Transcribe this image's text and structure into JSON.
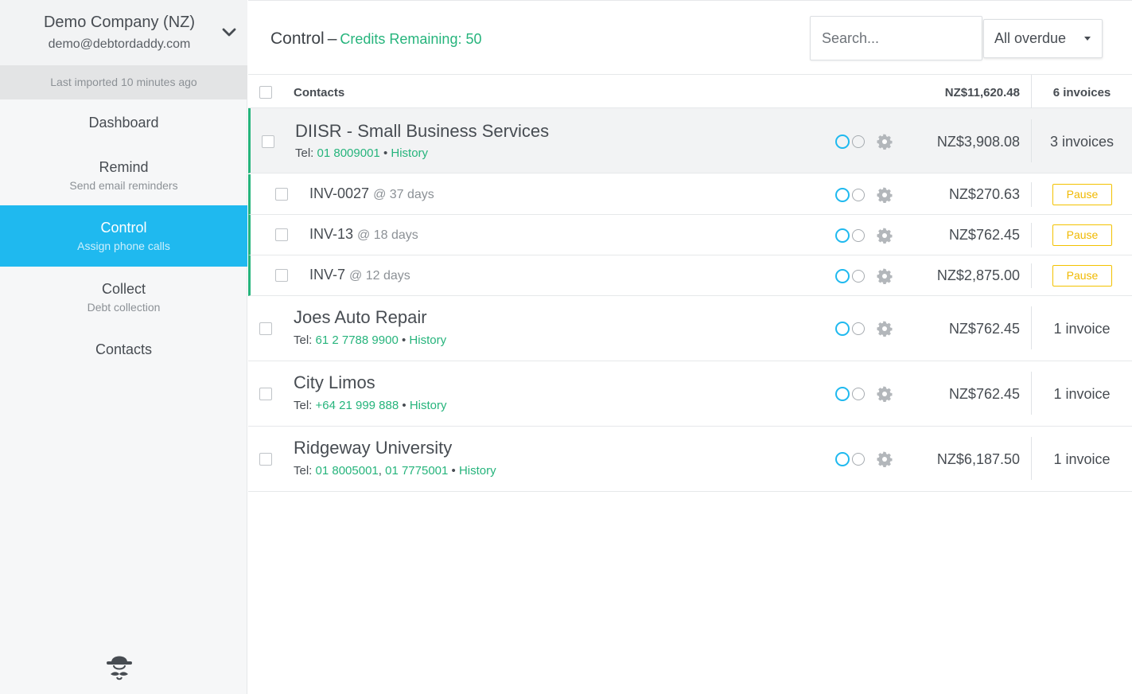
{
  "company": {
    "name": "Demo Company (NZ)",
    "email": "demo@debtordaddy.com",
    "last_imported": "Last imported 10 minutes ago"
  },
  "nav": [
    {
      "title": "Dashboard",
      "subtitle": ""
    },
    {
      "title": "Remind",
      "subtitle": "Send email reminders"
    },
    {
      "title": "Control",
      "subtitle": "Assign phone calls"
    },
    {
      "title": "Collect",
      "subtitle": "Debt collection"
    },
    {
      "title": "Contacts",
      "subtitle": ""
    }
  ],
  "header": {
    "title": "Control",
    "dash": "–",
    "credits": "Credits Remaining: 50",
    "search_placeholder": "Search...",
    "filter": "All overdue"
  },
  "table": {
    "contacts_label": "Contacts",
    "total": "NZ$11,620.48",
    "total_invoices": "6 invoices"
  },
  "rows": [
    {
      "name": "DIISR - Small Business Services",
      "tel_label": "Tel:",
      "phones": [
        "01 8009001"
      ],
      "history": "History",
      "amount": "NZ$3,908.08",
      "invoices": "3 invoices"
    },
    {
      "name": "Joes Auto Repair",
      "tel_label": "Tel:",
      "phones": [
        "61 2 7788 9900"
      ],
      "history": "History",
      "amount": "NZ$762.45",
      "invoices": "1 invoice"
    },
    {
      "name": "City Limos",
      "tel_label": "Tel:",
      "phones": [
        "+64 21 999 888"
      ],
      "history": "History",
      "amount": "NZ$762.45",
      "invoices": "1 invoice"
    },
    {
      "name": "Ridgeway University",
      "tel_label": "Tel:",
      "phones": [
        "01 8005001",
        "01 7775001"
      ],
      "history": "History",
      "amount": "NZ$6,187.50",
      "invoices": "1 invoice"
    }
  ],
  "invoices": [
    {
      "id": "INV-0027",
      "days": "@ 37 days",
      "amount": "NZ$270.63",
      "action": "Pause"
    },
    {
      "id": "INV-13",
      "days": "@ 18 days",
      "amount": "NZ$762.45",
      "action": "Pause"
    },
    {
      "id": "INV-7",
      "days": "@ 12 days",
      "amount": "NZ$2,875.00",
      "action": "Pause"
    }
  ],
  "separators": {
    "bullet": "•",
    "comma": ","
  },
  "icons": {
    "dropdown": "chevron-down-icon",
    "status": "status-circles-icon",
    "settings": "gear-icon",
    "logo": "detective-logo-icon"
  },
  "colors": {
    "accent": "#1fb9ef",
    "green": "#26b47c",
    "pause": "#f3c200"
  }
}
